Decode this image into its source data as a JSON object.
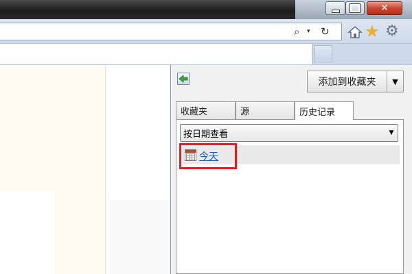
{
  "window": {
    "minimize_icon": "minimize-icon",
    "maximize_icon": "maximize-icon",
    "close_glyph": "✕"
  },
  "toolbar": {
    "search_glyph": "⌕",
    "dropdown_glyph": "▾",
    "refresh_glyph": "↻",
    "star_glyph": "★",
    "gear_glyph": "⚙"
  },
  "panel": {
    "add_to_favorites_label": "添加到收藏夹",
    "add_dropdown_glyph": "▼",
    "tabs": [
      {
        "label": "收藏夹"
      },
      {
        "label": "源"
      },
      {
        "label": "历史记录"
      }
    ],
    "view_select_value": "按日期查看",
    "view_select_arrow": "▼",
    "history_items": [
      {
        "label": "今天",
        "icon": "calendar-icon"
      }
    ]
  },
  "colors": {
    "highlight": "#e02020",
    "link": "#1a5fc9",
    "star": "#f3b21b"
  }
}
